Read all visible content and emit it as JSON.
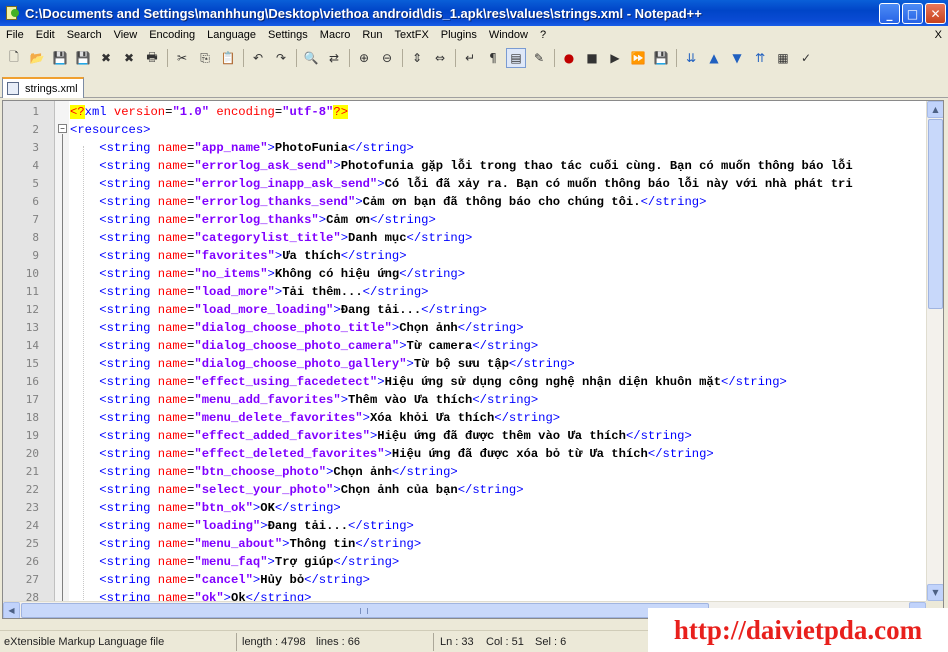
{
  "window": {
    "title": "C:\\Documents and Settings\\manhhung\\Desktop\\viethoa android\\dis_1.apk\\res\\values\\strings.xml - Notepad++",
    "buttons": {
      "minimize": "_",
      "maximize": "□",
      "close": "✕"
    }
  },
  "menu": {
    "items": [
      "File",
      "Edit",
      "Search",
      "View",
      "Encoding",
      "Language",
      "Settings",
      "Macro",
      "Run",
      "TextFX",
      "Plugins",
      "Window",
      "?"
    ],
    "close_doc": "X"
  },
  "toolbar": {
    "icons": [
      "new-file-icon",
      "open-file-icon",
      "save-icon",
      "save-all-icon",
      "close-icon",
      "close-all-icon",
      "print-icon",
      "cut-icon",
      "copy-icon",
      "paste-icon",
      "undo-icon",
      "redo-icon",
      "find-icon",
      "replace-icon",
      "zoom-in-icon",
      "zoom-out-icon",
      "sync-vertical-icon",
      "sync-horizontal-icon",
      "word-wrap-icon",
      "show-all-chars-icon",
      "indent-guide-icon",
      "user-language-icon",
      "record-macro-icon",
      "stop-record-icon",
      "play-macro-icon",
      "run-macro-multiple-icon",
      "save-macro-icon",
      "fold-all-icon",
      "up-icon",
      "down-icon",
      "unfold-all-icon",
      "clipboard-icon",
      "spell-check-icon"
    ],
    "glyphs": [
      "🗋",
      "📂",
      "💾",
      "💾",
      "✖",
      "✖",
      "🖶",
      "✂",
      "⎘",
      "📋",
      "↶",
      "↷",
      "🔍",
      "⇄",
      "⊕",
      "⊖",
      "⇕",
      "⇔",
      "↵",
      "¶",
      "▤",
      "✎",
      "●",
      "■",
      "▶",
      "⏩",
      "💾",
      "⇊",
      "▲",
      "▼",
      "⇈",
      "▦",
      "✓"
    ]
  },
  "tabs": [
    {
      "label": "strings.xml"
    }
  ],
  "editor": {
    "lines": [
      {
        "n": "1",
        "kind": "decl",
        "text": "<?xml version=\"1.0\" encoding=\"utf-8\"?>"
      },
      {
        "n": "2",
        "kind": "open",
        "text": "<resources>"
      },
      {
        "n": "3",
        "name": "app_name",
        "value": "PhotoFunia"
      },
      {
        "n": "4",
        "name": "errorlog_ask_send",
        "value": "Photofunia gặp lỗi trong thao tác cuối cùng. Bạn có muốn thông báo lỗi"
      },
      {
        "n": "5",
        "name": "errorlog_inapp_ask_send",
        "value": "Có lỗi đã xảy ra. Bạn có muốn thông báo lỗi này với nhà phát tri"
      },
      {
        "n": "6",
        "name": "errorlog_thanks_send",
        "value": "Cảm ơn bạn đã thông báo cho chúng tôi."
      },
      {
        "n": "7",
        "name": "errorlog_thanks",
        "value": "Cảm ơn"
      },
      {
        "n": "8",
        "name": "categorylist_title",
        "value": "Danh mục"
      },
      {
        "n": "9",
        "name": "favorites",
        "value": "Ưa thích"
      },
      {
        "n": "10",
        "name": "no_items",
        "value": "Không có hiệu ứng"
      },
      {
        "n": "11",
        "name": "load_more",
        "value": "Tải thêm..."
      },
      {
        "n": "12",
        "name": "load_more_loading",
        "value": "Đang tải..."
      },
      {
        "n": "13",
        "name": "dialog_choose_photo_title",
        "value": "Chọn ảnh"
      },
      {
        "n": "14",
        "name": "dialog_choose_photo_camera",
        "value": "Từ camera"
      },
      {
        "n": "15",
        "name": "dialog_choose_photo_gallery",
        "value": "Từ bộ sưu tập"
      },
      {
        "n": "16",
        "name": "effect_using_facedetect",
        "value": "Hiệu ứng sử dụng công nghệ nhận diện khuôn mặt"
      },
      {
        "n": "17",
        "name": "menu_add_favorites",
        "value": "Thêm vào Ưa thích"
      },
      {
        "n": "18",
        "name": "menu_delete_favorites",
        "value": "Xóa khỏi Ưa thích"
      },
      {
        "n": "19",
        "name": "effect_added_favorites",
        "value": "Hiệu ứng đã được thêm vào Ưa thích"
      },
      {
        "n": "20",
        "name": "effect_deleted_favorites",
        "value": "Hiệu ứng đã được xóa bỏ từ Ưa thích"
      },
      {
        "n": "21",
        "name": "btn_choose_photo",
        "value": "Chọn ảnh"
      },
      {
        "n": "22",
        "name": "select_your_photo",
        "value": "Chọn ảnh của bạn"
      },
      {
        "n": "23",
        "name": "btn_ok",
        "value": "OK"
      },
      {
        "n": "24",
        "name": "loading",
        "value": "Đang tải..."
      },
      {
        "n": "25",
        "name": "menu_about",
        "value": "Thông tin"
      },
      {
        "n": "26",
        "name": "menu_faq",
        "value": "Trợ giúp"
      },
      {
        "n": "27",
        "name": "cancel",
        "value": "Hủy bỏ"
      },
      {
        "n": "28",
        "name": "ok",
        "value": "Ok"
      }
    ]
  },
  "statusbar": {
    "file_type": "eXtensible Markup Language file",
    "length": "length : 4798",
    "lines": "lines : 66",
    "ln": "Ln : 33",
    "col": "Col : 51",
    "sel": "Sel : 6"
  },
  "watermark": {
    "text": "http://daivietpda.com",
    "color": "#e8201c"
  },
  "colors": {
    "titlebar": "#0a4bd4",
    "tag": "#0000ff",
    "attribute": "#ff0000",
    "attr_value": "#8000ff",
    "line_number_bg": "#e4e4e4"
  }
}
